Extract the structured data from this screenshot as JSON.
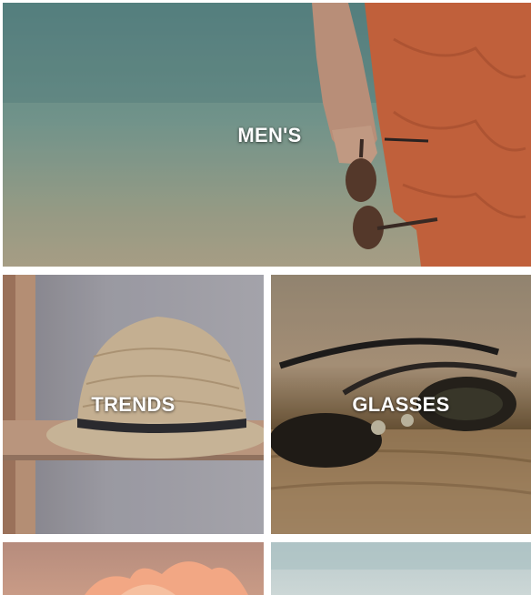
{
  "categories": {
    "mens": {
      "label": "MEN'S",
      "image": "man-in-orange-swim-shorts-holding-sunglasses"
    },
    "trends": {
      "label": "TRENDS",
      "image": "straw-fedora-hat-on-shelf"
    },
    "glasses": {
      "label": "GLASSES",
      "image": "sunglasses-closeup-on-wood"
    },
    "flowers": {
      "label": "",
      "image": "peach-flower-petals"
    },
    "beach": {
      "label": "",
      "image": "pale-blue-beach-scene"
    }
  },
  "colors": {
    "label_text": "#ffffff",
    "page_background": "#ffffff",
    "shorts_orange": "#d2673d"
  }
}
